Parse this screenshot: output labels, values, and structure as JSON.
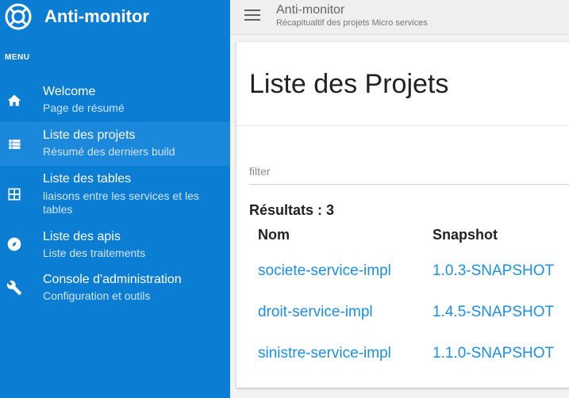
{
  "app": {
    "title": "Anti-monitor",
    "logo_icon": "lifebuoy-icon"
  },
  "sidebar": {
    "menu_header": "MENU",
    "items": [
      {
        "label": "Welcome",
        "subtitle": "Page de résumé",
        "icon": "home-icon",
        "active": false
      },
      {
        "label": "Liste des projets",
        "subtitle": "Résumé des derniers build",
        "icon": "list-icon",
        "active": true
      },
      {
        "label": "Liste des tables",
        "subtitle": "liaisons entre les services et les tables",
        "icon": "grid-icon",
        "active": false
      },
      {
        "label": "Liste des apis",
        "subtitle": "Liste des traitements",
        "icon": "compass-icon",
        "active": false
      },
      {
        "label": "Console d'administration",
        "subtitle": "Configuration et outils",
        "icon": "wrench-icon",
        "active": false
      }
    ]
  },
  "header": {
    "title": "Anti-monitor",
    "subtitle": "Récapitualtif des projets Micro services",
    "menu_icon": "hamburger-icon"
  },
  "main": {
    "title": "Liste des Projets",
    "filter_placeholder": "filter",
    "results_label": "Résultats : 3",
    "columns": [
      "Nom",
      "Snapshot"
    ],
    "rows": [
      {
        "name": "societe-service-impl",
        "snapshot": "1.0.3-SNAPSHOT"
      },
      {
        "name": "droit-service-impl",
        "snapshot": "1.4.5-SNAPSHOT"
      },
      {
        "name": "sinistre-service-impl",
        "snapshot": "1.1.0-SNAPSHOT"
      }
    ]
  },
  "colors": {
    "sidebar_bg": "#0b7ed4",
    "sidebar_active": "#1b88db",
    "link": "#1a8fe8"
  }
}
